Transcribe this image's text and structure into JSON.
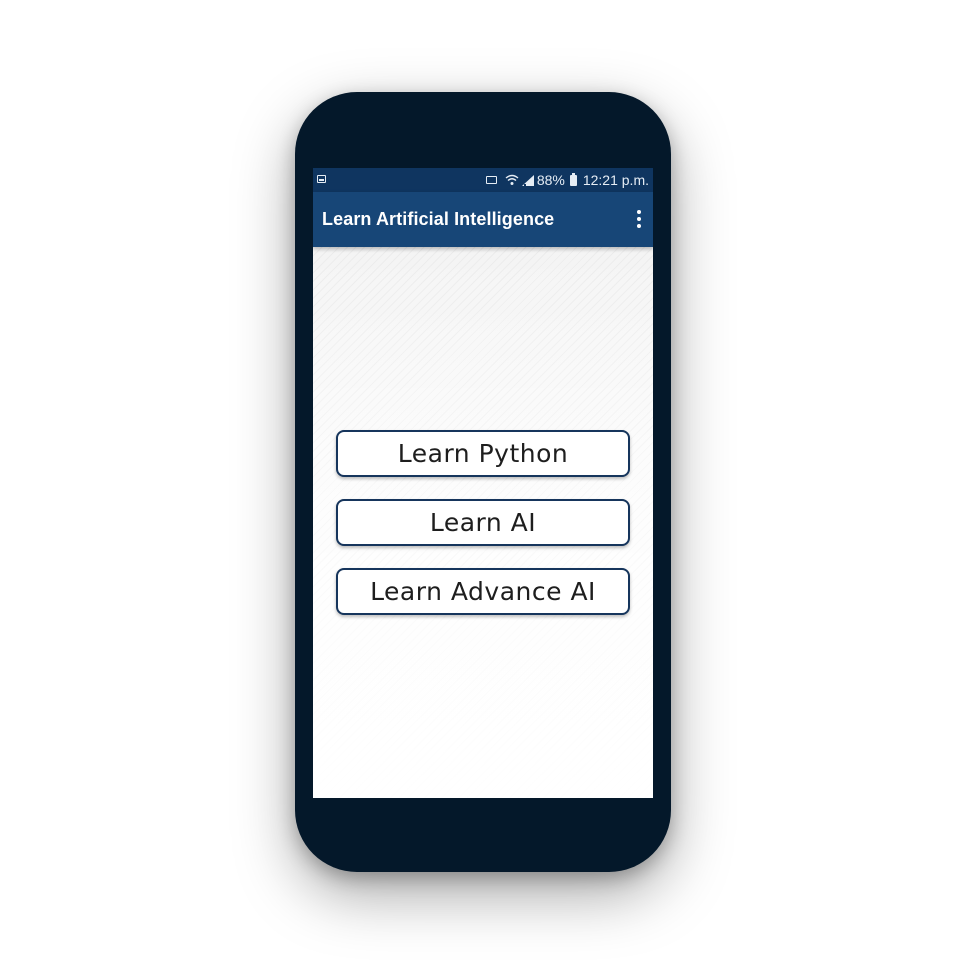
{
  "status_bar": {
    "battery_percent": "88%",
    "time": "12:21 p.m.",
    "icons": [
      "notification-icon",
      "cast-icon",
      "wifi-icon",
      "signal-icon",
      "battery-icon"
    ]
  },
  "app_bar": {
    "title": "Learn Artificial Intelligence",
    "menu_icon": "overflow-menu-icon"
  },
  "buttons": [
    {
      "label": "Learn Python"
    },
    {
      "label": "Learn AI"
    },
    {
      "label": "Learn Advance AI"
    }
  ],
  "colors": {
    "status_bar": "#0f3560",
    "app_bar": "#174677",
    "phone_body": "#04182a",
    "button_border": "#16355c"
  }
}
